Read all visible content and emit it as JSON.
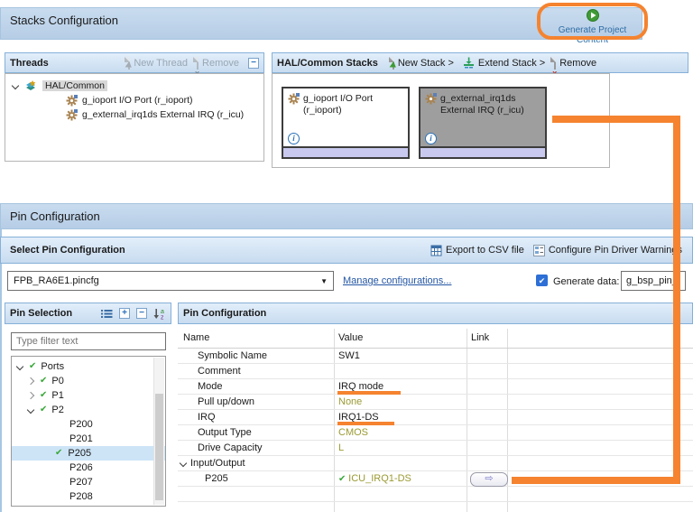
{
  "colors": {
    "annotation_orange": "#f5832f",
    "value_olive": "#9a9a33",
    "link_blue": "#2456a4",
    "check_green": "#3aa83a",
    "section_bar_blue": "#bdd3e9",
    "panel_header_blue": "#d4e4f4",
    "selected_stack_gray": "#9e9e9e",
    "stack_strip_purple": "#c9c9ef",
    "tree_selection_blue": "#cde4f7"
  },
  "stacks_configuration": {
    "title": "Stacks Configuration",
    "generate_button": "Generate Project Content",
    "threads": {
      "title": "Threads",
      "new_thread_button": "New Thread",
      "remove_button": "Remove",
      "tree": [
        {
          "label": "HAL/Common",
          "depth": 0,
          "icon": "hal-common-icon",
          "expander": "open",
          "selected": true
        },
        {
          "label": "g_ioport I/O Port (r_ioport)",
          "depth": 1,
          "icon": "module-icon"
        },
        {
          "label": "g_external_irq1ds External IRQ (r_icu)",
          "depth": 1,
          "icon": "module-icon"
        }
      ]
    },
    "stacks": {
      "title": "HAL/Common Stacks",
      "new_stack_button": "New Stack >",
      "extend_stack_button": "Extend Stack >",
      "remove_button": "Remove",
      "cards": [
        {
          "lines": [
            "g_ioport I/O Port",
            "(r_ioport)"
          ],
          "selected": false
        },
        {
          "lines": [
            "g_external_irq1ds",
            "External IRQ (r_icu)"
          ],
          "selected": true
        }
      ]
    }
  },
  "pin_configuration": {
    "title": "Pin Configuration",
    "select_bar": {
      "title": "Select Pin Configuration",
      "export_button": "Export to CSV file",
      "configure_button": "Configure Pin Driver Warnings"
    },
    "config_row": {
      "pincfg_value": "FPB_RA6E1.pincfg",
      "manage_link": "Manage configurations...",
      "generate_checkbox_checked": true,
      "generate_label": "Generate data:",
      "generate_data_value": "g_bsp_pin_cfg"
    },
    "pin_selection": {
      "title": "Pin Selection",
      "filter_placeholder": "Type filter text",
      "tree": [
        {
          "label": "Ports",
          "depth": 0,
          "checked": true,
          "expander": "open"
        },
        {
          "label": "P0",
          "depth": 1,
          "checked": true,
          "expander": "closed"
        },
        {
          "label": "P1",
          "depth": 1,
          "checked": true,
          "expander": "closed"
        },
        {
          "label": "P2",
          "depth": 1,
          "checked": true,
          "expander": "open"
        },
        {
          "label": "P200",
          "depth": 2
        },
        {
          "label": "P201",
          "depth": 2
        },
        {
          "label": "P205",
          "depth": 2,
          "checked": true,
          "selected": true
        },
        {
          "label": "P206",
          "depth": 2
        },
        {
          "label": "P207",
          "depth": 2
        },
        {
          "label": "P208",
          "depth": 2
        }
      ]
    },
    "pin_config_table": {
      "title": "Pin Configuration",
      "columns": [
        "Name",
        "Value",
        "Link"
      ],
      "rows": [
        {
          "name": "Symbolic Name",
          "value": "SW1"
        },
        {
          "name": "Comment",
          "value": ""
        },
        {
          "name": "Mode",
          "value": "IRQ mode",
          "annotated": true
        },
        {
          "name": "Pull up/down",
          "value": "None",
          "value_color": "olive"
        },
        {
          "name": "IRQ",
          "value": "IRQ1-DS",
          "annotated": true
        },
        {
          "name": "Output Type",
          "value": "CMOS",
          "value_color": "olive"
        },
        {
          "name": "Drive Capacity",
          "value": "L",
          "value_color": "olive"
        },
        {
          "name": "Input/Output",
          "value": "",
          "expander": "open"
        },
        {
          "name": "P205",
          "value": "ICU_IRQ1-DS",
          "value_color": "olive",
          "checked": true,
          "link_button": true,
          "depth": 2
        },
        {
          "name": "",
          "value": ""
        },
        {
          "name": "",
          "value": ""
        }
      ]
    }
  },
  "annotations": {
    "color": "#f5832f",
    "shapes": [
      "oval-around-generate-project-content",
      "connector-selected-stack-to-p205-link-row"
    ]
  }
}
